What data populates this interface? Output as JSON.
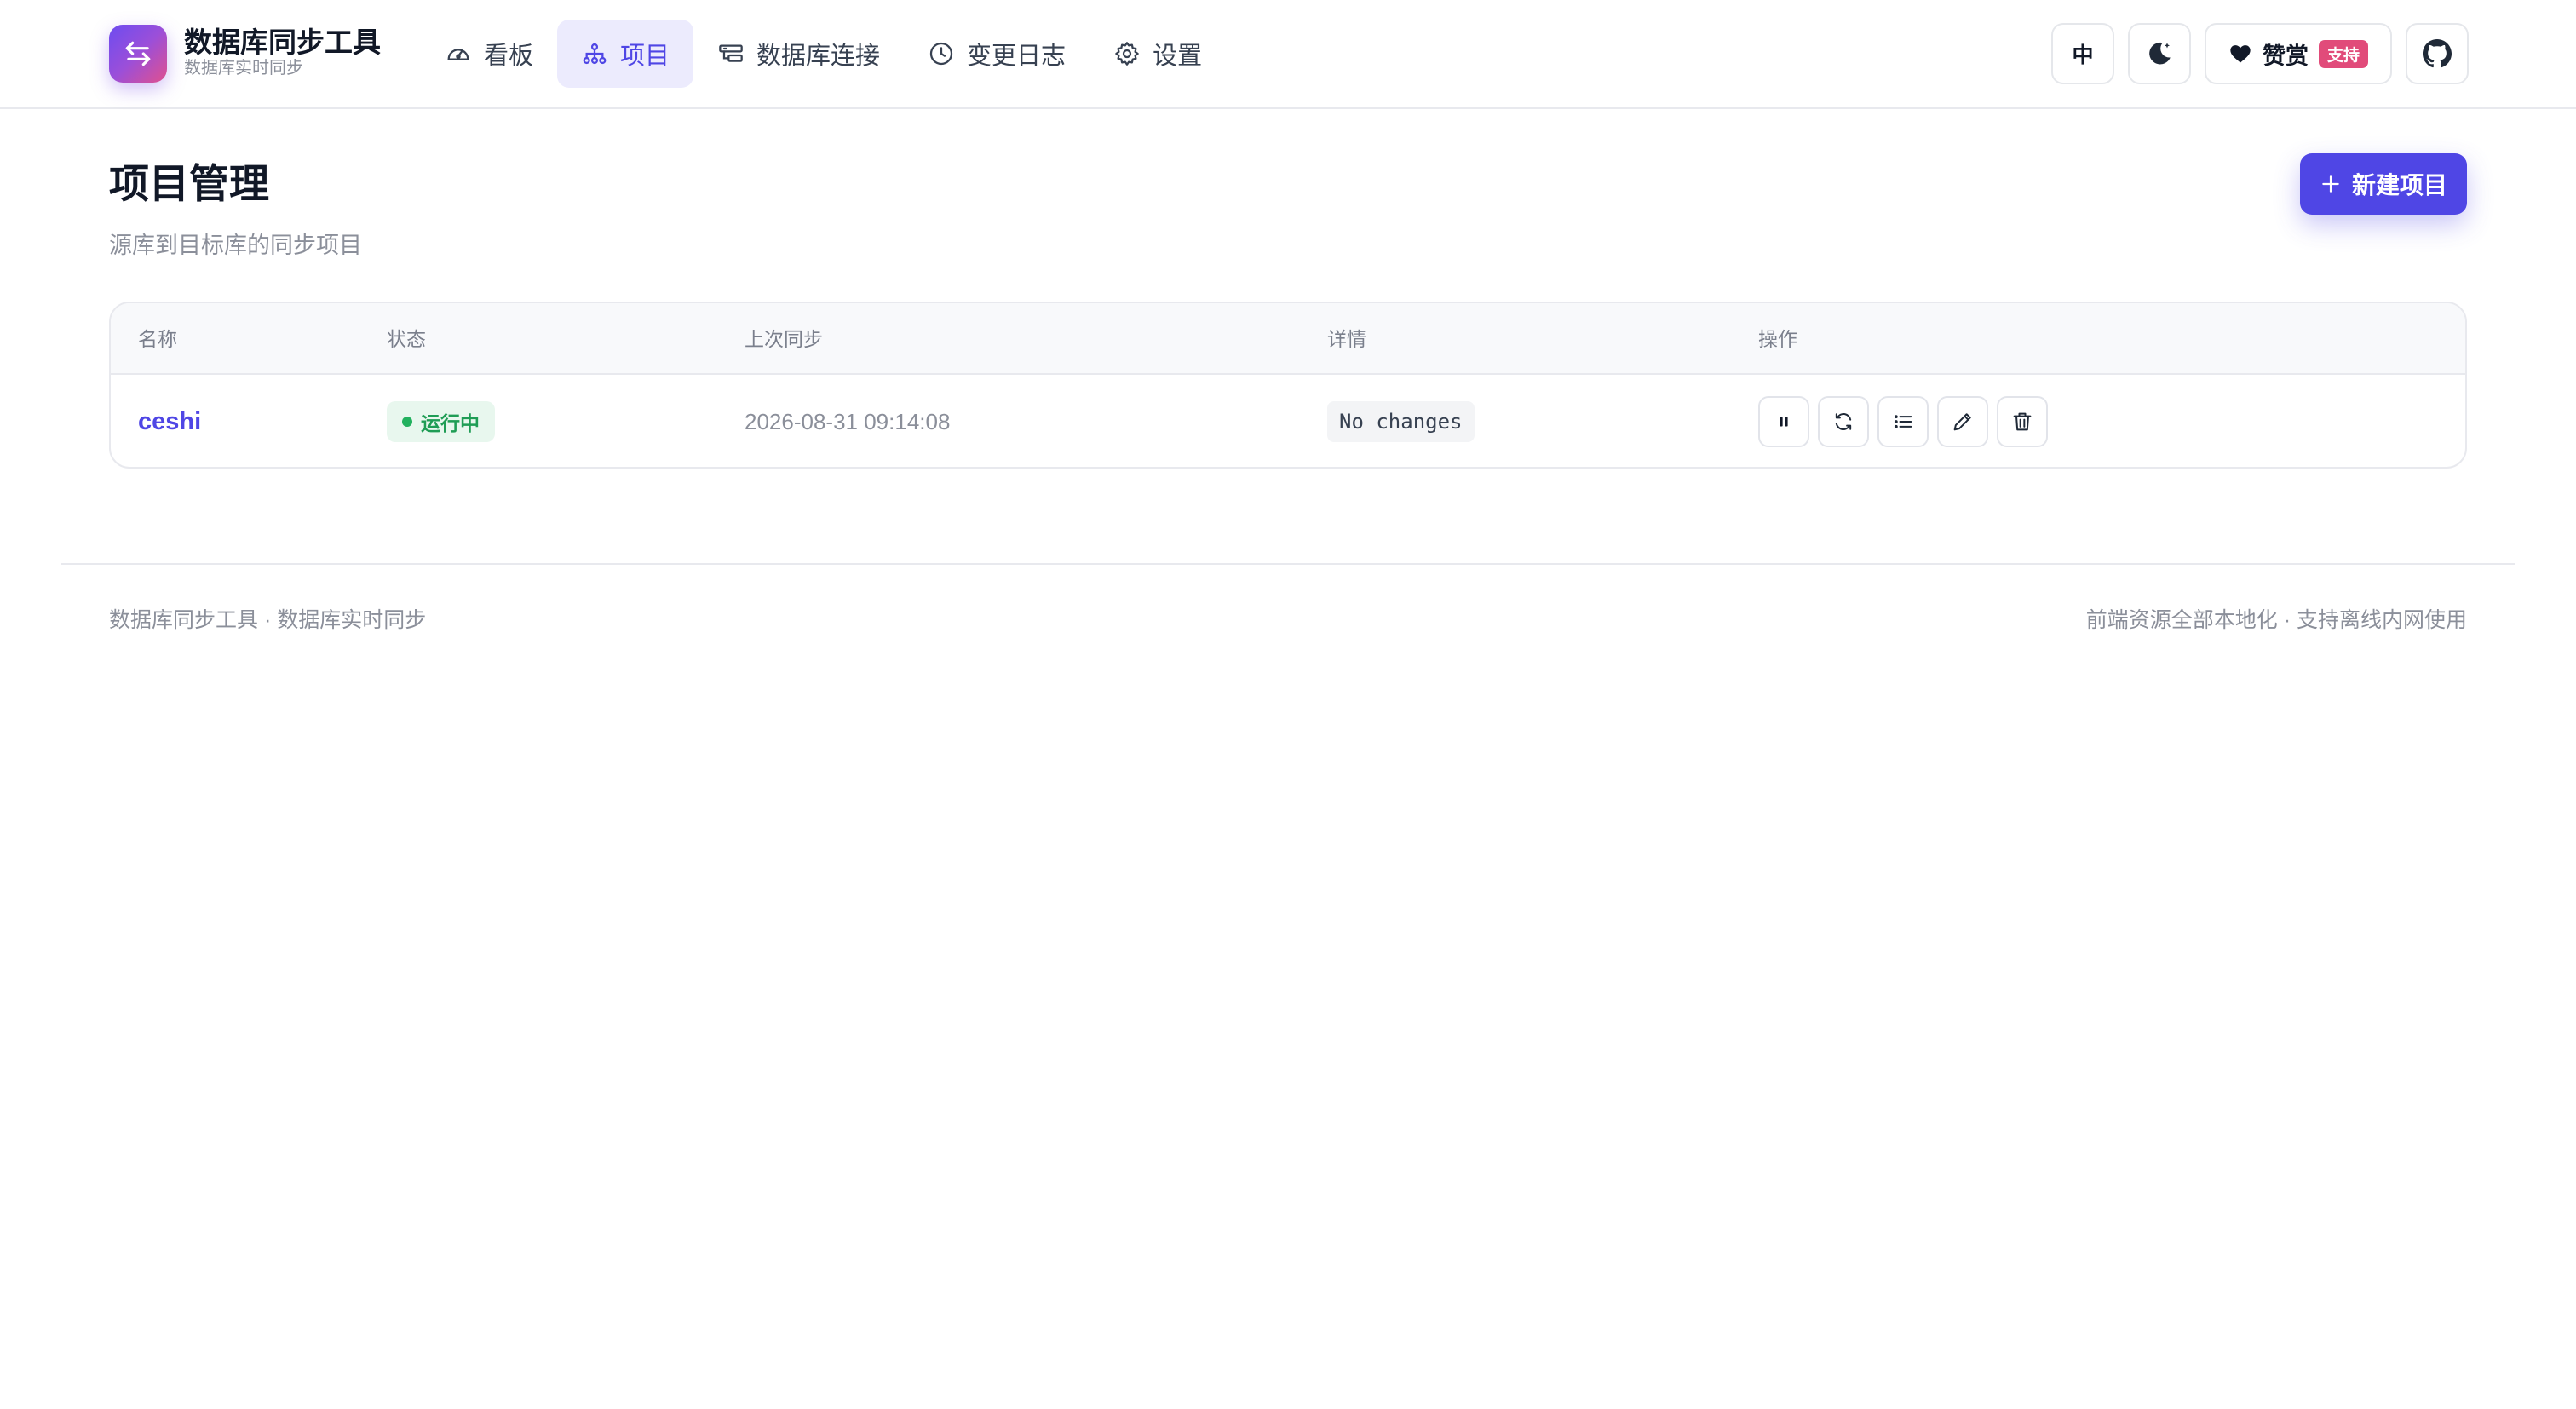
{
  "app": {
    "title": "数据库同步工具",
    "subtitle": "数据库实时同步",
    "accent_color": "#4f46e5"
  },
  "nav": {
    "items": [
      {
        "label": "看板",
        "icon": "dashboard-gauge-icon",
        "active": false
      },
      {
        "label": "项目",
        "icon": "project-hierarchy-icon",
        "active": true
      },
      {
        "label": "数据库连接",
        "icon": "database-connection-icon",
        "active": false
      },
      {
        "label": "变更日志",
        "icon": "clock-icon",
        "active": false
      },
      {
        "label": "设置",
        "icon": "gear-icon",
        "active": false
      }
    ]
  },
  "header_actions": {
    "language_label": "中",
    "theme_icon": "moon-icon",
    "donate_label": "赞赏",
    "donate_badge": "支持",
    "github_icon": "github-icon"
  },
  "page": {
    "title": "项目管理",
    "subtitle": "源库到目标库的同步项目",
    "new_button_label": "新建项目"
  },
  "table": {
    "columns": [
      "名称",
      "状态",
      "上次同步",
      "详情",
      "操作"
    ],
    "rows": [
      {
        "name": "ceshi",
        "status": "运行中",
        "status_color": "#1f9d55",
        "last_sync": "2026-08-31 09:14:08",
        "detail": "No changes",
        "actions": [
          "pause-icon",
          "refresh-icon",
          "list-icon",
          "edit-pencil-icon",
          "trash-icon"
        ]
      }
    ]
  },
  "footer": {
    "left": "数据库同步工具 · 数据库实时同步",
    "right": "前端资源全部本地化 · 支持离线内网使用"
  }
}
